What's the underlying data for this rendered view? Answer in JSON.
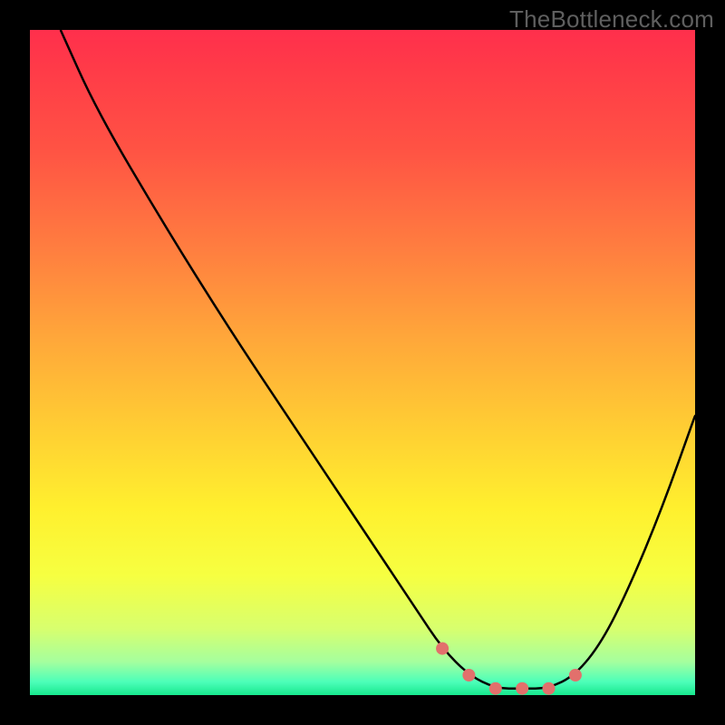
{
  "watermark": "TheBottleneck.com",
  "colors": {
    "bg": "#000000",
    "curve": "#000000",
    "dots": "#e2706c",
    "gradient_top": "#ff2f4c",
    "gradient_bottom": "#17e88e"
  },
  "chart_data": {
    "type": "line",
    "title": "",
    "xlabel": "",
    "ylabel": "",
    "xlim": [
      0,
      100
    ],
    "ylim": [
      0,
      100
    ],
    "curve": {
      "x": [
        4.6,
        10,
        20,
        30,
        40,
        50,
        58,
        62,
        66,
        70,
        74,
        78,
        82,
        86,
        90,
        95,
        100
      ],
      "percent": [
        100,
        88,
        71,
        55,
        40,
        25,
        13,
        7,
        3,
        1,
        1,
        1,
        3,
        8,
        16,
        28,
        42
      ]
    },
    "optimal_zone": {
      "x": [
        62,
        66,
        70,
        74,
        78,
        82
      ],
      "percent": [
        7,
        3,
        1,
        1,
        1,
        3
      ]
    },
    "annotations": []
  }
}
